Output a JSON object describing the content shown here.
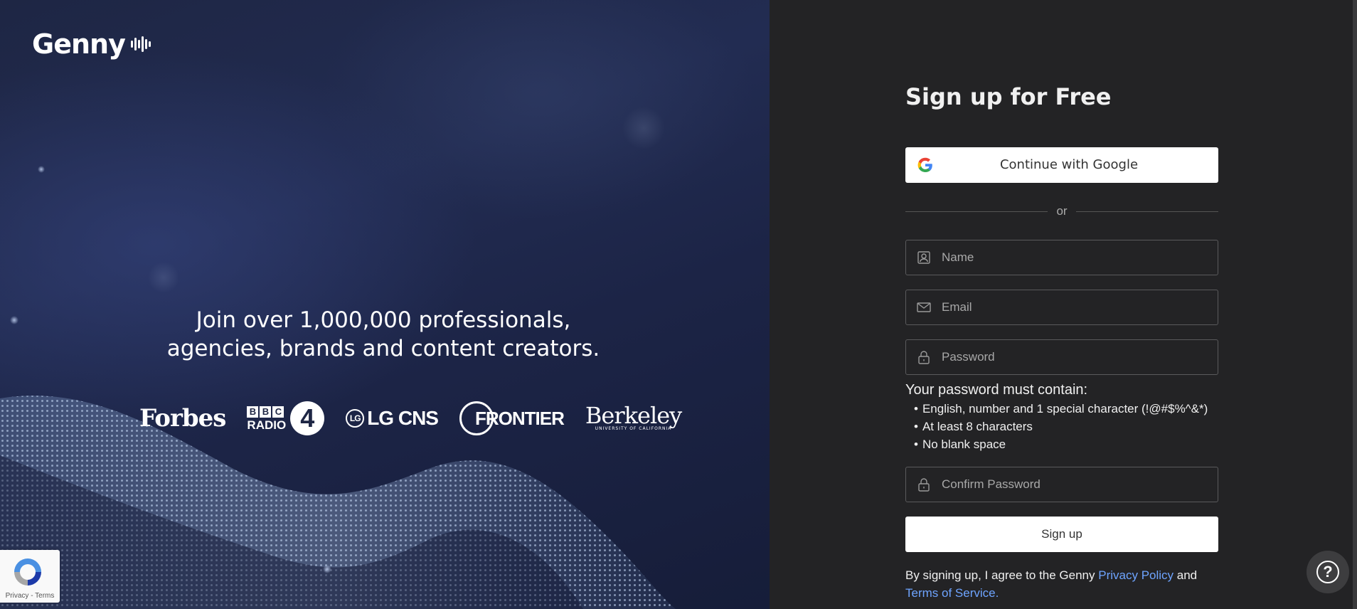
{
  "brand": {
    "name": "Genny"
  },
  "hero": {
    "tagline_line1": "Join over 1,000,000 professionals,",
    "tagline_line2": "agencies, brands and content creators.",
    "partners": {
      "forbes": "Forbes",
      "bbc_boxes": [
        "B",
        "B",
        "C"
      ],
      "bbc_radio": "RADIO",
      "bbc_number": "4",
      "lg_mark": "LG",
      "lg_text": "LG CNS",
      "frontier": "FRONTIER",
      "berkeley": "Berkeley",
      "berkeley_sub": "UNIVERSITY OF CALIFORNIA"
    }
  },
  "form": {
    "title": "Sign up for Free",
    "google_button": "Continue with Google",
    "divider": "or",
    "name_placeholder": "Name",
    "email_placeholder": "Email",
    "password_placeholder": "Password",
    "confirm_placeholder": "Confirm Password",
    "rules_title": "Your password must contain:",
    "rules": [
      "English, number and 1 special character (!@#$%^&*)",
      "At least 8 characters",
      "No blank space"
    ],
    "signup_button": "Sign up",
    "terms_prefix": "By signing up, I agree to the Genny ",
    "privacy_link": "Privacy Policy",
    "terms_middle": " and",
    "terms_link": "Terms of Service."
  },
  "recaptcha": {
    "links": "Privacy - Terms"
  },
  "help": {
    "label": "?"
  },
  "colors": {
    "link": "#6ea4ff",
    "panel": "#232325",
    "hero": "#1e2644"
  }
}
